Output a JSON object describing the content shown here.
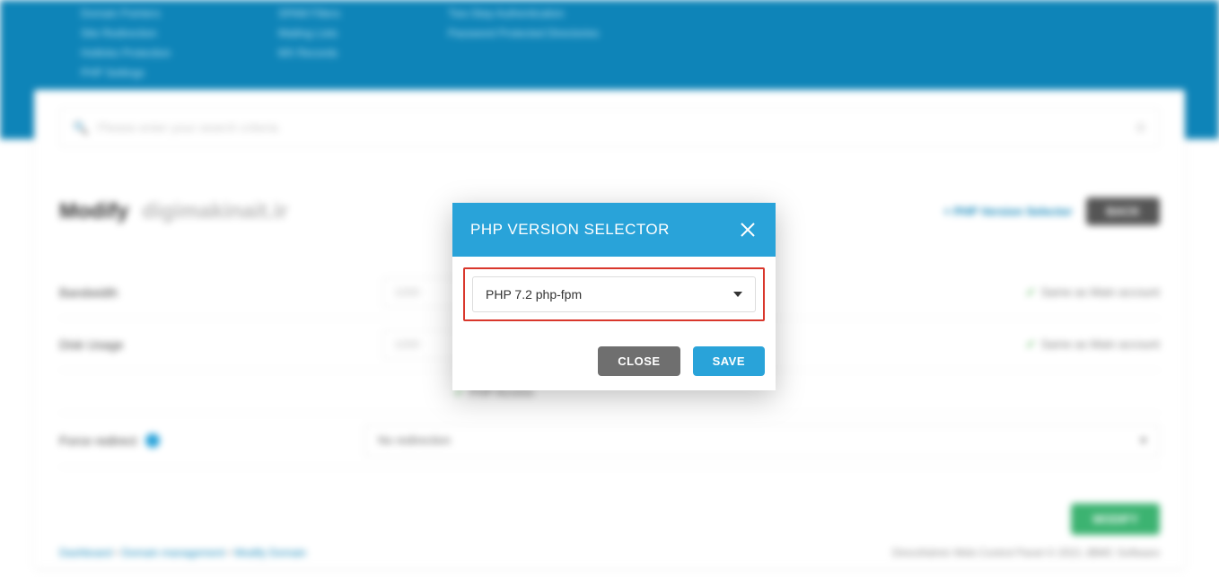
{
  "topbar": {
    "col1": [
      "Domain Pointers",
      "Site Redirection",
      "Hotlinks Protection",
      "PHP Settings"
    ],
    "col2": [
      "SPAM Filters",
      "Mailing Lists",
      "MX Records"
    ],
    "col3": [
      "Two-Step Authentication",
      "Password Protected Directories"
    ]
  },
  "search": {
    "placeholder": "Please enter your search criteria"
  },
  "page": {
    "title_prefix": "Modify",
    "domain": "digimakinait.ir",
    "php_link": "+ PHP Version Selector",
    "back_label": "BACK"
  },
  "rows": {
    "bandwidth_label": "Bandwidth",
    "bandwidth_value": "1000",
    "disk_label": "Disk Usage",
    "disk_value": "1000",
    "same_label": "Same as Main account",
    "php_access": "PHP Access",
    "force_label": "Force redirect",
    "force_value": "No redirection"
  },
  "modify_button": "MODIFY",
  "footer": {
    "crumbs": [
      "Dashboard",
      "Domain management",
      "Modify Domain"
    ],
    "copyright": "DirectAdmin Web Control Panel © 2021 JBMC Software"
  },
  "modal": {
    "title": "PHP VERSION SELECTOR",
    "selected": "PHP 7.2 php-fpm",
    "close_label": "CLOSE",
    "save_label": "SAVE"
  }
}
